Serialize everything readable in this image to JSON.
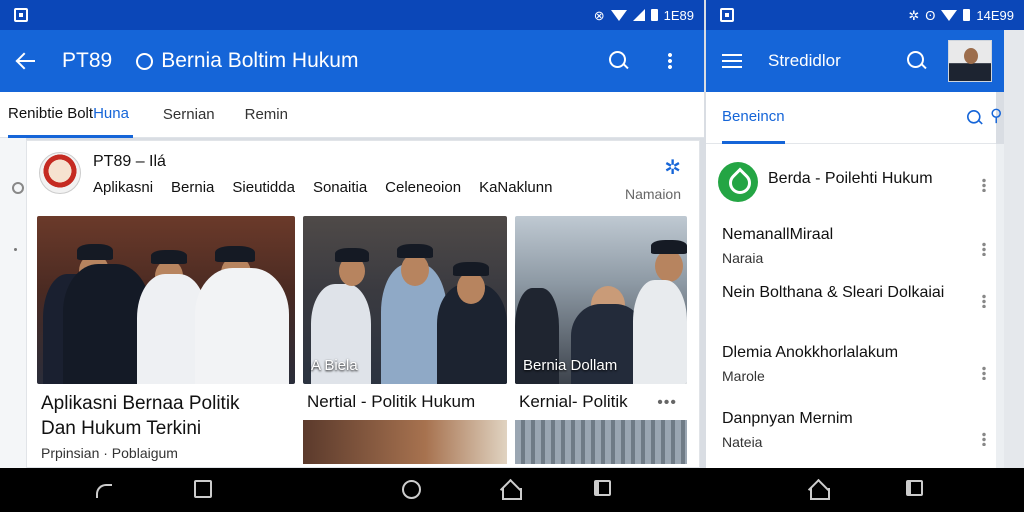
{
  "status_left": {
    "time": "1E89",
    "icons": [
      "alarm-icon",
      "wifi-icon",
      "signal-icon",
      "battery-icon"
    ]
  },
  "status_right": {
    "time": "14E99",
    "icons": [
      "vibrate-icon",
      "wifi-icon",
      "signal-icon",
      "battery-icon"
    ]
  },
  "appbar": {
    "code": "PT89",
    "title": "Bernia Boltim Hukum"
  },
  "tabs": {
    "tab1_a": "Renibtie Bolt",
    "tab1_b": "Huna",
    "tab2": "Sernian",
    "tab3": "Remin"
  },
  "card": {
    "source_name": "PT89 – Ilá",
    "categories": [
      "Aplikasni",
      "Bernia",
      "Sieutidda",
      "Sonaitia",
      "Celeneoion",
      "KaNaklunn"
    ],
    "header_label": "Namaion",
    "tiles": [
      {
        "title_line1": "Aplikasni Bernaa Politik",
        "title_line2": "Dan Hukum Terkini",
        "sub": "Prpinsian  · Poblaigum"
      },
      {
        "caption": "A Biela",
        "title": "Nertial - Politik Hukum"
      },
      {
        "caption": "Bernia Dollam",
        "title": "Kernial- Politik"
      }
    ]
  },
  "right": {
    "bar_title": "Stredidlor",
    "tab": "Beneincn",
    "items": [
      {
        "title": "Berda - Poilehti Hukum",
        "sub": ""
      },
      {
        "title": "NemanallMiraal",
        "sub": "Naraia"
      },
      {
        "title": "Nein Bolthana & Sleari Dolkaiai",
        "sub": ""
      },
      {
        "title": "Dlemia Anokkhorlalakum",
        "sub": "Marole"
      },
      {
        "title": "Danpnyan Mernim",
        "sub": "Nateia"
      }
    ]
  },
  "colors": {
    "appbar": "#1565d8",
    "statusbar": "#0b47b8",
    "accent": "#1565d8",
    "green": "#24a544"
  }
}
